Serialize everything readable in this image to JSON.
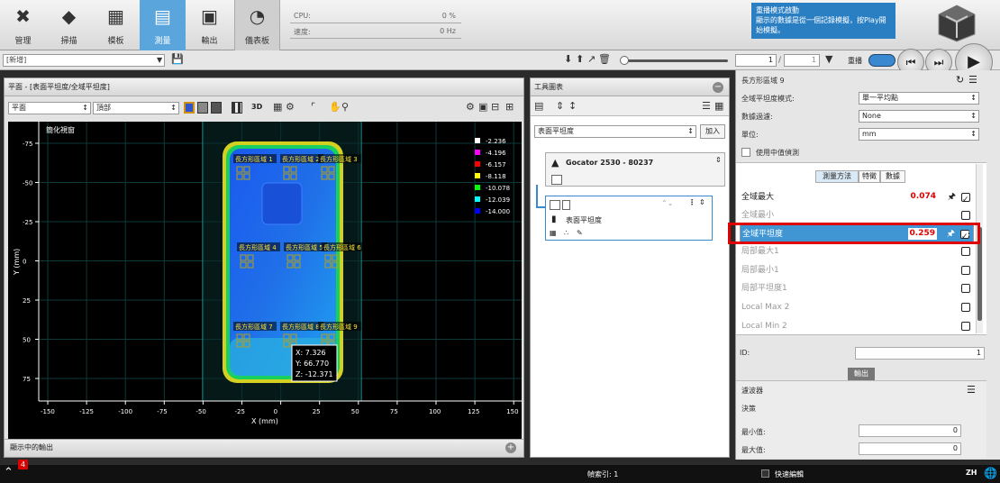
{
  "nav": [
    {
      "label": "管理",
      "icon": "tools-icon"
    },
    {
      "label": "掃描",
      "icon": "scan-icon"
    },
    {
      "label": "模板",
      "icon": "cubes-icon"
    },
    {
      "label": "測量",
      "icon": "ruler-icon"
    },
    {
      "label": "輸出",
      "icon": "output-icon"
    },
    {
      "label": "儀表板",
      "icon": "gauge-icon"
    }
  ],
  "stats": {
    "cpu_label": "CPU:",
    "cpu_value": "0 %",
    "speed_label": "速度:",
    "speed_value": "0 Hz"
  },
  "replay": {
    "title": "重播模式啟動",
    "text": "顯示的數據是從一個記錄模擬，按Play開始模擬。"
  },
  "toolbar2": {
    "scope": "[新增]",
    "frame_current": "1",
    "frame_total": "1",
    "replay_label": "重播"
  },
  "left": {
    "title": "平面 - [表面平坦度/全域平坦度]",
    "view_select": "平面",
    "top_select": "頂部",
    "mode_3d": "3D",
    "footer": "顯示中的輸出",
    "overlay_label": "簡化視窗",
    "y_axis_label": "Y (mm)",
    "x_axis_label": "X (mm)",
    "x_ticks": [
      "-150",
      "-125",
      "-100",
      "-75",
      "-50",
      "-25",
      "0",
      "25",
      "50",
      "75",
      "100",
      "125",
      "150"
    ],
    "y_ticks": [
      "-75",
      "-50",
      "-25",
      "0",
      "25",
      "50",
      "75"
    ],
    "legend": [
      {
        "value": "-2.236",
        "color": "#ffffff"
      },
      {
        "value": "-4.196",
        "color": "#ff00ff"
      },
      {
        "value": "-6.157",
        "color": "#ff0000"
      },
      {
        "value": "-8.118",
        "color": "#ffff00"
      },
      {
        "value": "-10.078",
        "color": "#00ff00"
      },
      {
        "value": "-12.039",
        "color": "#00ffff"
      },
      {
        "value": "-14.000",
        "color": "#0000ff"
      }
    ],
    "regions": [
      "長方形區域 1",
      "長方形區域 2",
      "長方形區域 3",
      "長方形區域 4",
      "長方形區域 5",
      "長方形區域 6",
      "長方形區域 7",
      "長方形區域 8",
      "長方形區域 9"
    ],
    "tooltip": {
      "x": "X: 7.326",
      "y": "Y: 66.770",
      "z": "Z: -12.371"
    }
  },
  "mid": {
    "title": "工具圖表",
    "tool_select": "表面平坦度",
    "add_button": "加入",
    "sensor_name": "Gocator 2530 - 80237",
    "tool_name": "表面平坦度"
  },
  "right": {
    "region_title": "長方形區域 9",
    "flatness_mode_label": "全域平坦度模式:",
    "flatness_mode_value": "單一平均點",
    "filter_label": "數據過濾:",
    "filter_value": "None",
    "unit_label": "單位:",
    "unit_value": "mm",
    "median_label": "使用中值偵測",
    "tabs": [
      "測量方法",
      "特徵",
      "數據"
    ],
    "measurements": [
      {
        "label": "全域最大",
        "value": "0.074",
        "checked": true
      },
      {
        "label": "全域最小",
        "value": "",
        "checked": false
      },
      {
        "label": "全域平坦度",
        "value": "0.259",
        "checked": true
      },
      {
        "label": "局部最大1",
        "value": "",
        "checked": false
      },
      {
        "label": "局部最小1",
        "value": "",
        "checked": false
      },
      {
        "label": "局部平坦度1",
        "value": "",
        "checked": false
      },
      {
        "label": "Local Max 2",
        "value": "",
        "checked": false
      },
      {
        "label": "Local Min 2",
        "value": "",
        "checked": false
      }
    ],
    "id_label": "ID:",
    "id_value": "1",
    "output_button": "輸出",
    "filter_section_label": "濾波器",
    "decision_label": "決策",
    "min_label": "最小值:",
    "min_value": "0",
    "max_label": "最大值:",
    "max_value": "0"
  },
  "status": {
    "badge": "4",
    "frame_index": "幀索引: 1",
    "quick_edit": "快速編輯",
    "lang": "ZH"
  }
}
